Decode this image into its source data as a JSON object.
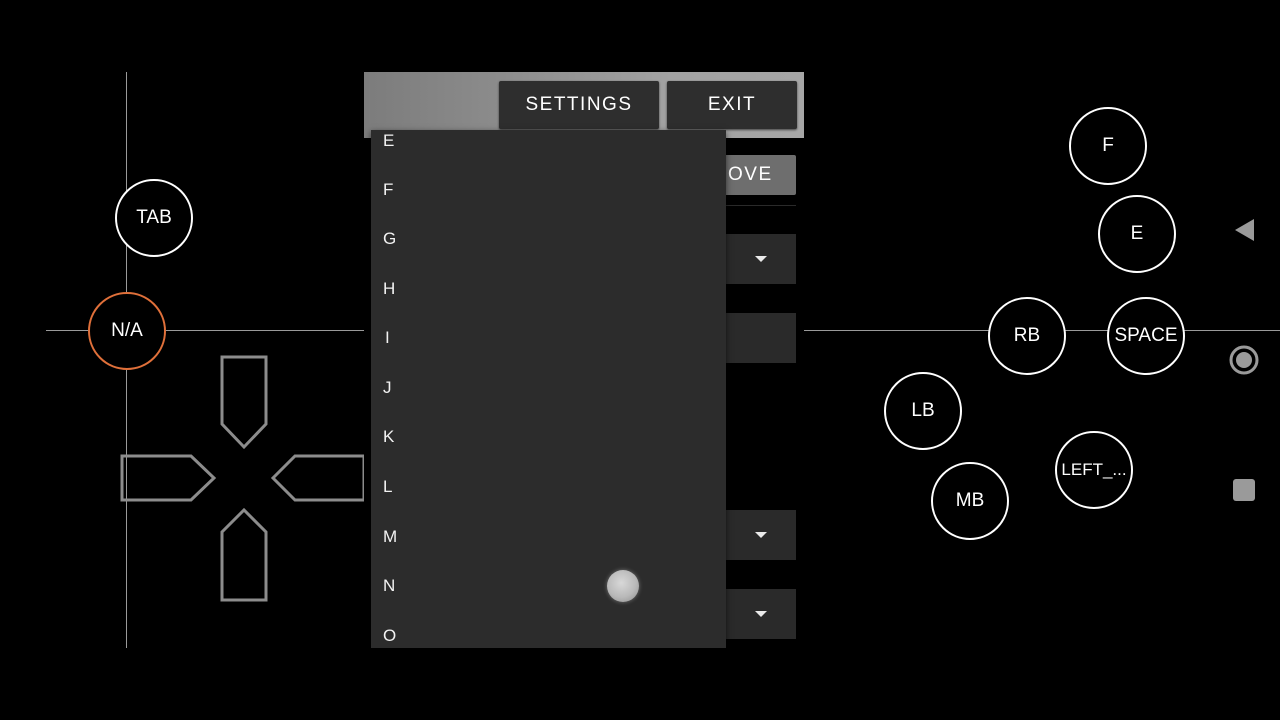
{
  "panel": {
    "settings_label": "SETTINGS",
    "exit_label": "EXIT",
    "move_label": "OVE"
  },
  "dropdown": {
    "items": [
      "E",
      "F",
      "G",
      "H",
      "I",
      "J",
      "K",
      "L",
      "M",
      "N",
      "O"
    ]
  },
  "controls": {
    "tab": "TAB",
    "na": "N/A",
    "f": "F",
    "e": "E",
    "rb": "RB",
    "space": "SPACE",
    "lb": "LB",
    "mb": "MB",
    "left": "LEFT_..."
  },
  "colors": {
    "background": "#000000",
    "accent_active": "#e0703a",
    "panel_button": "#2e2e2e",
    "dropdown_bg": "#2c2c2c"
  },
  "icons": {
    "back": "back-triangle-icon",
    "home": "home-circle-icon",
    "recents": "recents-square-icon"
  }
}
